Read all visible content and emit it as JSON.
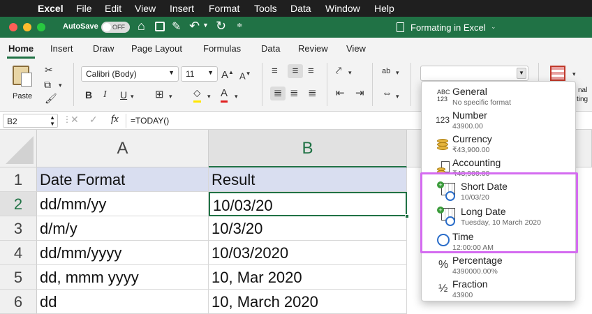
{
  "menubar": {
    "apple": "",
    "app": "Excel",
    "items": [
      "File",
      "Edit",
      "View",
      "Insert",
      "Format",
      "Tools",
      "Data",
      "Window",
      "Help"
    ]
  },
  "titlebar": {
    "autosave_label": "AutoSave",
    "autosave_state": "OFF",
    "doc_title": "Formating in Excel"
  },
  "tabs": [
    "Home",
    "Insert",
    "Draw",
    "Page Layout",
    "Formulas",
    "Data",
    "Review",
    "View"
  ],
  "ribbon": {
    "paste_label": "Paste",
    "font_name": "Calibri (Body)",
    "font_size": "11",
    "number_format_value": "",
    "partial_labels": [
      "nal",
      "ting"
    ]
  },
  "formula_bar": {
    "name_box": "B2",
    "fx": "fx",
    "formula": "=TODAY()"
  },
  "grid": {
    "columns": [
      "A",
      "B"
    ],
    "rows": [
      {
        "num": "1",
        "a": "Date Format",
        "b": "Result"
      },
      {
        "num": "2",
        "a": "dd/mm/yy",
        "b": "10/03/20"
      },
      {
        "num": "3",
        "a": "d/m/y",
        "b": "10/3/20"
      },
      {
        "num": "4",
        "a": "dd/mm/yyyy",
        "b": "10/03/2020"
      },
      {
        "num": "5",
        "a": "dd, mmm yyyy",
        "b": "10, Mar 2020"
      },
      {
        "num": "6",
        "a": "dd",
        "b": "10, March 2020"
      }
    ],
    "header_fill": "#d9def0",
    "selected_cell": "B2"
  },
  "number_formats": [
    {
      "name": "General",
      "example": "No specific format",
      "icon": "abc-123-icon"
    },
    {
      "name": "Number",
      "example": "43900.00",
      "icon": "123-icon"
    },
    {
      "name": "Currency",
      "example": "₹43,900.00",
      "icon": "coins-icon"
    },
    {
      "name": "Accounting",
      "example": "₹43,900.00",
      "icon": "ledger-coins-icon"
    },
    {
      "name": "Short Date",
      "example": "10/03/20",
      "icon": "calendar-clock-icon"
    },
    {
      "name": "Long Date",
      "example": "Tuesday, 10 March 2020",
      "icon": "calendar-clock-icon"
    },
    {
      "name": "Time",
      "example": "12:00:00 AM",
      "icon": "clock-icon"
    },
    {
      "name": "Percentage",
      "example": "4390000.00%",
      "icon": "percent-icon"
    },
    {
      "name": "Fraction",
      "example": "43900",
      "icon": "fraction-icon"
    }
  ],
  "colors": {
    "excel_green": "#207245",
    "highlight": "#d46bf0"
  }
}
